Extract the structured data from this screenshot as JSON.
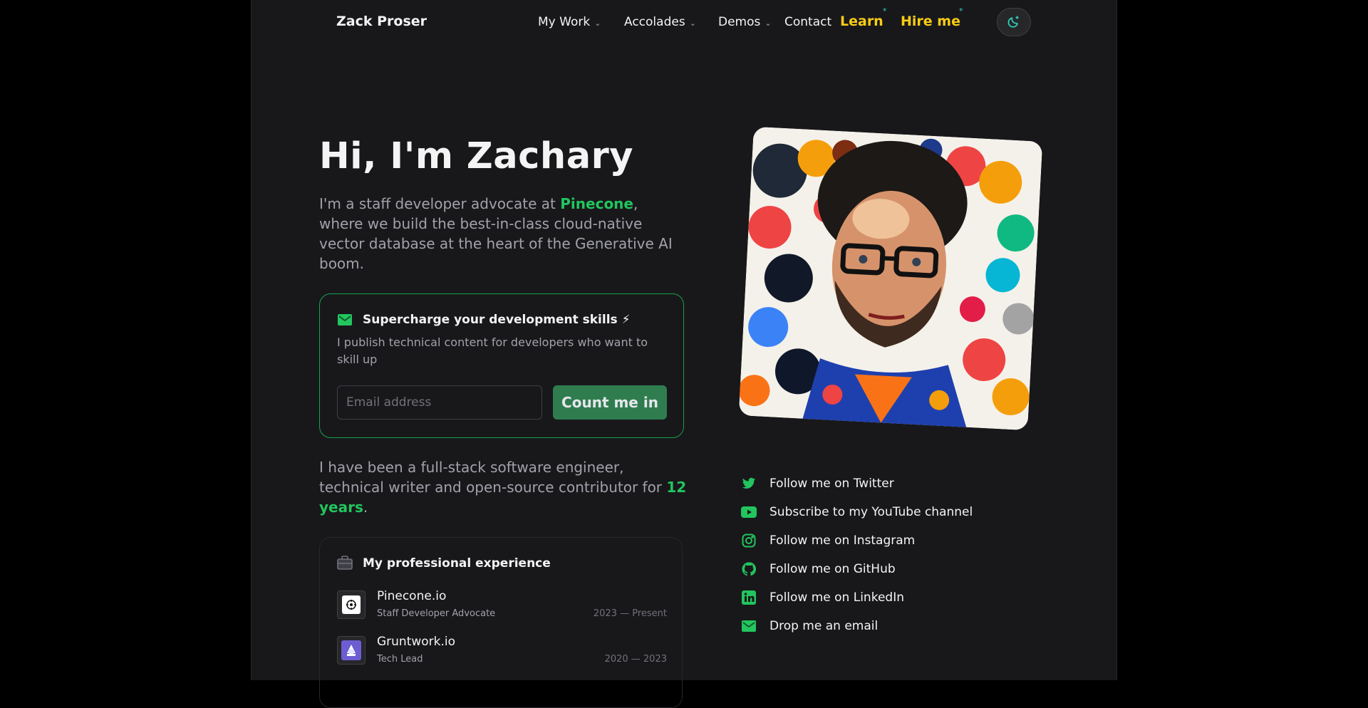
{
  "header": {
    "brand": "Zack Proser",
    "nav": [
      {
        "label": "My Work"
      },
      {
        "label": "Accolades"
      },
      {
        "label": "Demos"
      },
      {
        "label": "Contact"
      }
    ],
    "learn_label": "Learn",
    "hire_label": "Hire me",
    "star_glyph": "*",
    "theme_icon": "moon-sparkle-icon"
  },
  "hero": {
    "title": "Hi, I'm Zachary",
    "intro_pre": "I'm a staff developer advocate at ",
    "intro_company": "Pinecone",
    "intro_post": ", where we build the best-in-class cloud-native vector database at the heart of the Generative AI boom."
  },
  "newsletter": {
    "title": "Supercharge your development skills ⚡",
    "description": "I publish technical content for developers who want to skill up",
    "email_placeholder": "Email address",
    "email_value": "",
    "button_label": "Count me in"
  },
  "experience_intro": {
    "pre": "I have been a full-stack software engineer, technical writer and open-source contributor for ",
    "years": "12 years",
    "post": "."
  },
  "experience": {
    "title": "My professional experience",
    "jobs": [
      {
        "company": "Pinecone.io",
        "role": "Staff Developer Advocate",
        "dates": "2023 — Present"
      },
      {
        "company": "Gruntwork.io",
        "role": "Tech Lead",
        "dates": "2020 — 2023"
      }
    ]
  },
  "social": [
    {
      "label": "Follow me on Twitter",
      "icon": "twitter-icon"
    },
    {
      "label": "Subscribe to my YouTube channel",
      "icon": "youtube-icon"
    },
    {
      "label": "Follow me on Instagram",
      "icon": "instagram-icon"
    },
    {
      "label": "Follow me on GitHub",
      "icon": "github-icon"
    },
    {
      "label": "Follow me on LinkedIn",
      "icon": "linkedin-icon"
    },
    {
      "label": "Drop me an email",
      "icon": "mail-icon"
    }
  ],
  "colors": {
    "accent_green": "#22c55e",
    "accent_yellow": "#facc15",
    "page_bg": "#18181b",
    "button_green": "#2f7d4f"
  }
}
